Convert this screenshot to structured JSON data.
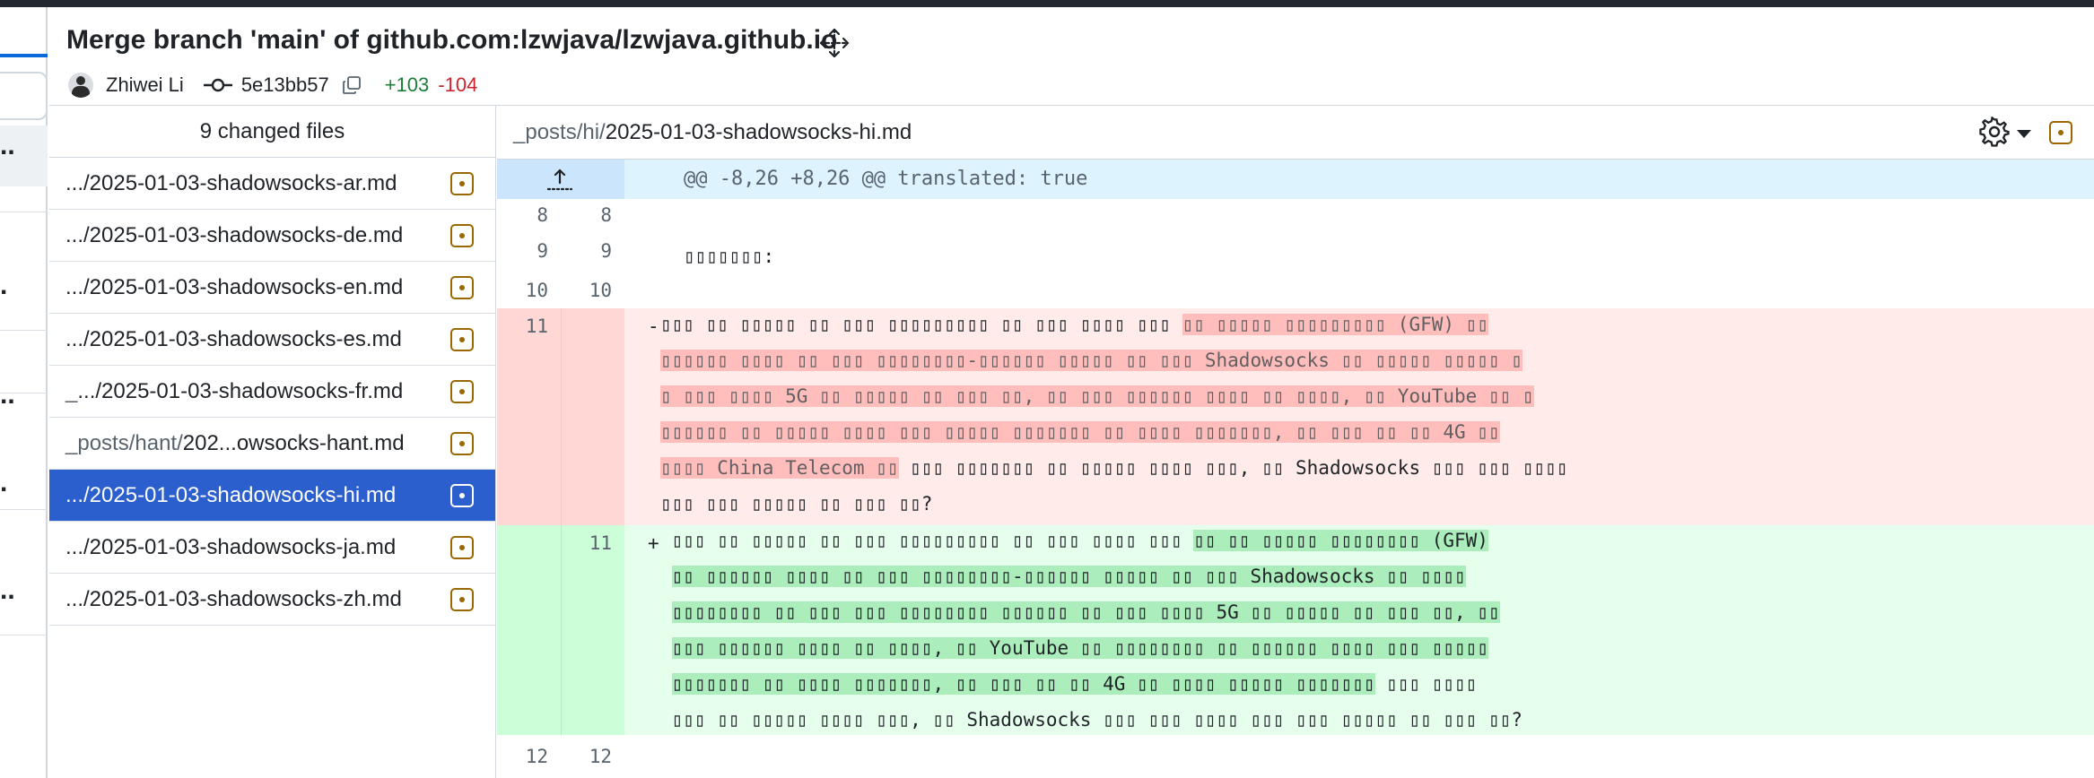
{
  "commit": {
    "title": "Merge branch 'main' of github.com:lzwjava/lzwjava.github.io",
    "author": "Zhiwei Li",
    "sha": "5e13bb57",
    "additions": "+103",
    "deletions": "-104"
  },
  "file_list": {
    "header": "9 changed files",
    "items": [
      {
        "dim": "",
        "name": ".../2025-01-03-shadowsocks-ar.md",
        "active": false
      },
      {
        "dim": "",
        "name": ".../2025-01-03-shadowsocks-de.md",
        "active": false
      },
      {
        "dim": "",
        "name": ".../2025-01-03-shadowsocks-en.md",
        "active": false
      },
      {
        "dim": "",
        "name": ".../2025-01-03-shadowsocks-es.md",
        "active": false
      },
      {
        "dim": "_",
        "name": ".../2025-01-03-shadowsocks-fr.md",
        "active": false
      },
      {
        "dim": "_posts/hant/",
        "name": "202...owsocks-hant.md",
        "active": false
      },
      {
        "dim": "",
        "name": ".../2025-01-03-shadowsocks-hi.md",
        "active": true
      },
      {
        "dim": "",
        "name": ".../2025-01-03-shadowsocks-ja.md",
        "active": false
      },
      {
        "dim": "",
        "name": ".../2025-01-03-shadowsocks-zh.md",
        "active": false
      }
    ]
  },
  "diff": {
    "path_dim": "_posts/hi/",
    "path_name": "2025-01-03-shadowsocks-hi.md",
    "hunk_header": "@@ -8,26 +8,26 @@ translated: true",
    "context_lines": [
      {
        "old": "8",
        "new": "8",
        "text": ""
      },
      {
        "old": "9",
        "new": "9",
        "text": "▯▯▯▯▯▯▯:"
      },
      {
        "old": "10",
        "new": "10",
        "text": ""
      }
    ],
    "deleted": {
      "old": "11",
      "sign": "-",
      "lines": [
        "▯▯▯ ▯▯ ▯▯▯▯▯ ▯▯ ▯▯▯ ▯▯▯▯▯▯▯▯▯ ▯▯ ▯▯▯ ▯▯▯▯ ▯▯▯ ▯▯ ▯▯▯▯▯ ▯▯▯▯▯▯▯▯▯ (GFW) ▯▯",
        "▯▯▯▯▯▯ ▯▯▯▯ ▯▯ ▯▯▯ ▯▯▯▯▯▯▯▯-▯▯▯▯▯▯ ▯▯▯▯▯ ▯▯ ▯▯▯ Shadowsocks ▯▯ ▯▯▯▯▯ ▯▯▯▯▯ ▯",
        "▯ ▯▯▯ ▯▯▯▯ 5G ▯▯ ▯▯▯▯▯ ▯▯ ▯▯▯ ▯▯, ▯▯ ▯▯▯ ▯▯▯▯▯▯ ▯▯▯▯ ▯▯ ▯▯▯▯, ▯▯ YouTube ▯▯ ▯",
        "▯▯▯▯▯▯ ▯▯ ▯▯▯▯▯ ▯▯▯▯ ▯▯▯ ▯▯▯▯▯ ▯▯▯▯▯▯▯ ▯▯ ▯▯▯▯ ▯▯▯▯▯▯▯, ▯▯ ▯▯▯ ▯▯ ▯▯ 4G ▯▯",
        "▯▯▯▯ China Telecom ▯▯ ▯▯▯ ▯▯▯▯▯▯▯ ▯▯ ▯▯▯▯▯ ▯▯▯▯ ▯▯▯, ▯▯ Shadowsocks ▯▯▯ ▯▯▯ ▯▯▯▯",
        "▯▯▯ ▯▯▯ ▯▯▯▯▯ ▯▯ ▯▯▯ ▯▯?"
      ]
    },
    "added": {
      "new": "11",
      "sign": "+",
      "lines": [
        " ▯▯▯ ▯▯ ▯▯▯▯▯ ▯▯ ▯▯▯ ▯▯▯▯▯▯▯▯▯ ▯▯ ▯▯▯ ▯▯▯▯ ▯▯▯ ▯▯ ▯▯ ▯▯▯▯▯ ▯▯▯▯▯▯▯▯ (GFW)",
        " ▯▯ ▯▯▯▯▯▯ ▯▯▯▯ ▯▯ ▯▯▯ ▯▯▯▯▯▯▯▯-▯▯▯▯▯▯ ▯▯▯▯▯ ▯▯ ▯▯▯ Shadowsocks ▯▯ ▯▯▯▯",
        " ▯▯▯▯▯▯▯▯ ▯▯ ▯▯▯ ▯▯▯ ▯▯▯▯▯▯▯▯ ▯▯▯▯▯▯ ▯▯ ▯▯▯ ▯▯▯▯ 5G ▯▯ ▯▯▯▯▯ ▯▯ ▯▯▯ ▯▯, ▯▯",
        " ▯▯▯ ▯▯▯▯▯▯ ▯▯▯▯ ▯▯ ▯▯▯▯, ▯▯ YouTube ▯▯ ▯▯▯▯▯▯▯▯ ▯▯ ▯▯▯▯▯▯ ▯▯▯▯ ▯▯▯ ▯▯▯▯▯",
        " ▯▯▯▯▯▯▯ ▯▯ ▯▯▯▯ ▯▯▯▯▯▯▯, ▯▯ ▯▯▯ ▯▯ ▯▯ 4G ▯▯ ▯▯▯▯ ▯▯▯▯▯ ▯▯▯▯▯▯▯ ▯▯▯ ▯▯▯▯",
        " ▯▯▯ ▯▯ ▯▯▯▯▯ ▯▯▯▯ ▯▯▯, ▯▯ Shadowsocks ▯▯▯ ▯▯▯ ▯▯▯▯ ▯▯▯ ▯▯▯ ▯▯▯▯▯ ▯▯ ▯▯▯ ▯▯?"
      ]
    },
    "trailing": {
      "old": "12",
      "new": "12"
    }
  },
  "icons": {
    "move": "move-icon",
    "commit": "git-commit-icon",
    "copy": "copy-icon",
    "file_status": "file-modified-icon",
    "settings": "gear-icon",
    "expand": "expand-up-icon"
  },
  "colors": {
    "additions": "#1a7f37",
    "deletions": "#cf222e",
    "active_file": "#2b5fce",
    "modified_badge": "#9a6700"
  }
}
